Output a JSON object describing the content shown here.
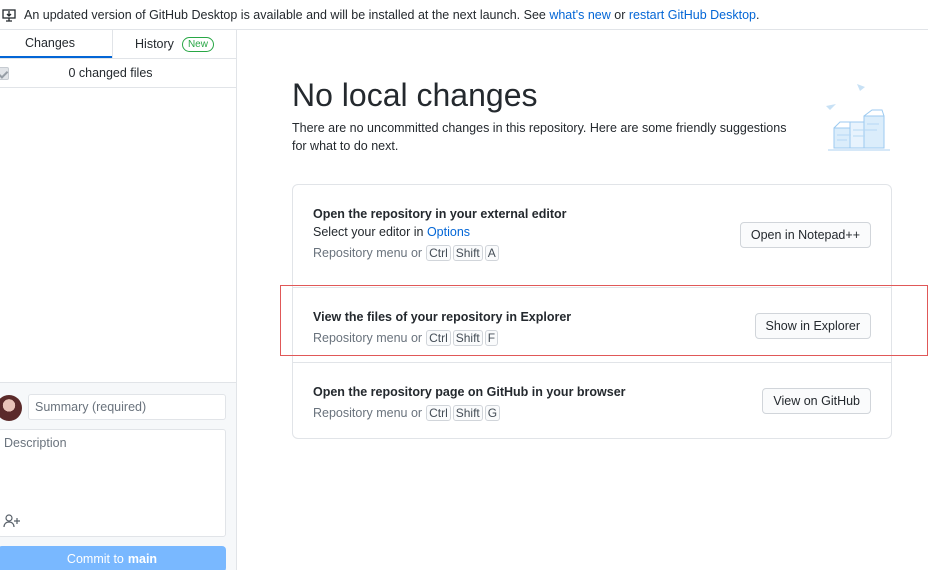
{
  "banner": {
    "icon": "desktop-download-icon",
    "text_before": "An updated version of GitHub Desktop is available and will be installed at the next launch. See ",
    "link_whats_new": "what's new",
    "text_or": " or ",
    "link_restart": "restart GitHub Desktop",
    "text_end": "."
  },
  "sidebar": {
    "tabs": [
      {
        "label": "Changes",
        "active": true
      },
      {
        "label": "History",
        "badge": "New"
      }
    ],
    "changed_files": "0 changed files",
    "commit": {
      "summary_placeholder": "Summary (required)",
      "description_placeholder": "Description",
      "button_prefix": "Commit to",
      "branch": "main"
    }
  },
  "main": {
    "title": "No local changes",
    "subtitle": "There are no uncommitted changes in this repository. Here are some friendly suggestions for what to do next.",
    "cards": [
      {
        "title": "Open the repository in your external editor",
        "sub_prefix": "Select your editor in ",
        "sub_link": "Options",
        "shortcut_prefix": "Repository menu or",
        "keys": [
          "Ctrl",
          "Shift",
          "A"
        ],
        "button": "Open in Notepad++"
      },
      {
        "title": "View the files of your repository in Explorer",
        "shortcut_prefix": "Repository menu or",
        "keys": [
          "Ctrl",
          "Shift",
          "F"
        ],
        "button": "Show in Explorer"
      },
      {
        "title": "Open the repository page on GitHub in your browser",
        "shortcut_prefix": "Repository menu or",
        "keys": [
          "Ctrl",
          "Shift",
          "G"
        ],
        "button": "View on GitHub"
      }
    ]
  },
  "colors": {
    "link": "#0366d6",
    "new_badge": "#28a745",
    "commit_button": "#79b8ff",
    "highlight": "#e05858"
  }
}
